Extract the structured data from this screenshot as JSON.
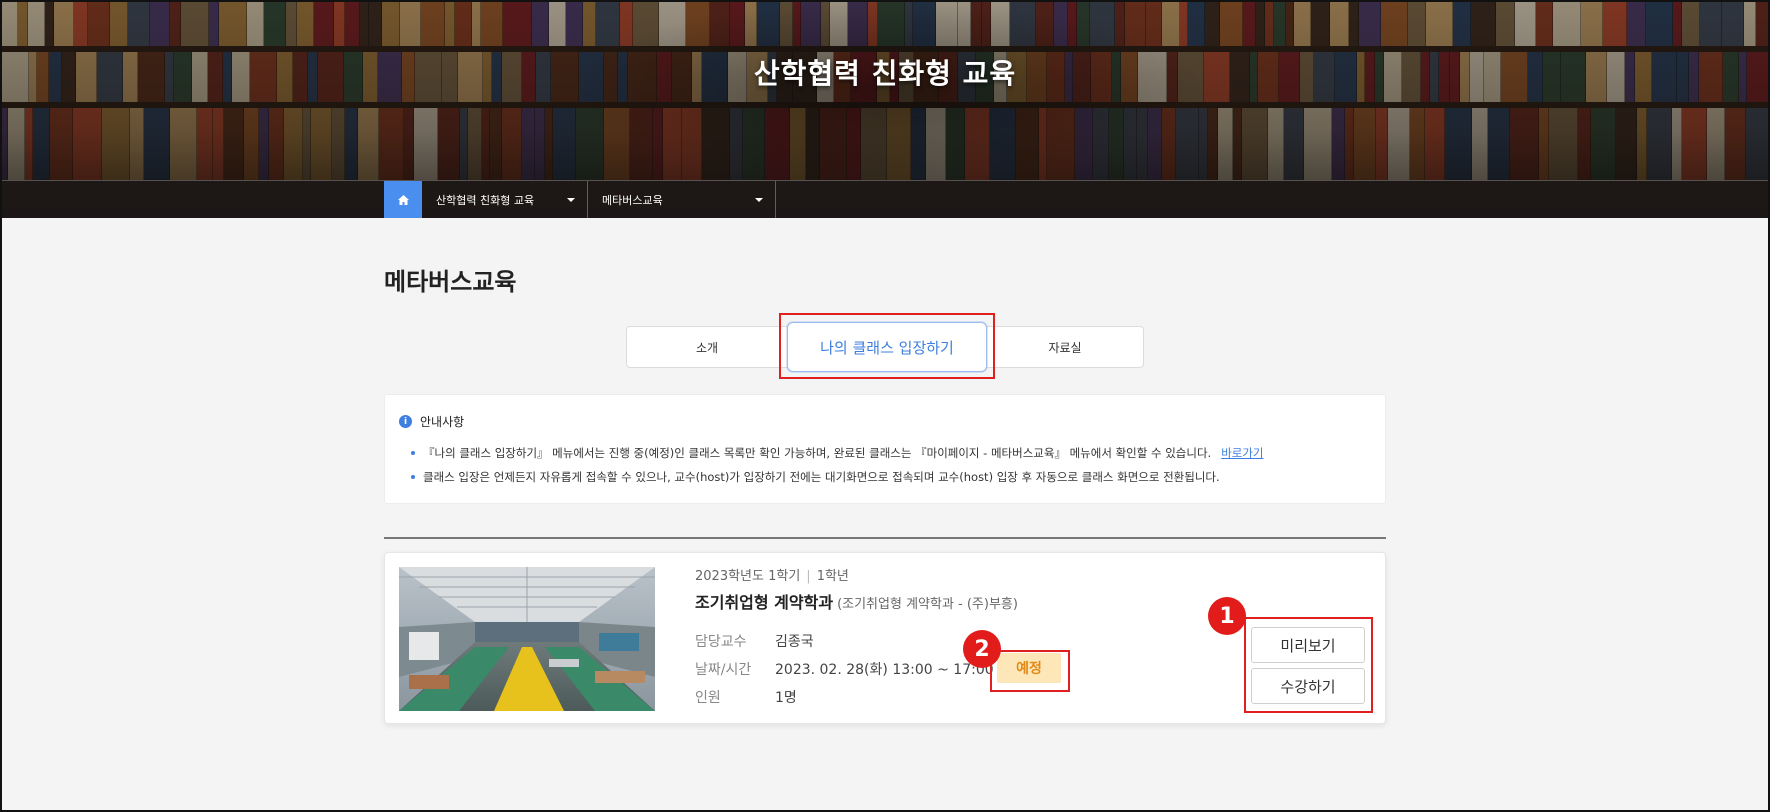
{
  "banner": {
    "title": "산학협력 친화형 교육"
  },
  "nav": {
    "home_icon": "home-icon",
    "item1": "산학협력 친화형 교육",
    "item2": "메타버스교육"
  },
  "page": {
    "title": "메타버스교육"
  },
  "tabs": [
    {
      "label": "소개"
    },
    {
      "label": "나의 클래스 입장하기"
    },
    {
      "label": "자료실"
    }
  ],
  "notice": {
    "heading": "안내사항",
    "line1": "『나의 클래스 입장하기』 메뉴에서는 진행 중(예정)인 클래스 목록만 확인 가능하며, 완료된 클래스는 『마이페이지 - 메타버스교육』 메뉴에서 확인할 수 있습니다.",
    "link": "바로가기",
    "line2": "클래스 입장은 언제든지 자유롭게 접속할 수 있으나, 교수(host)가 입장하기 전에는 대기화면으로 접속되며 교수(host) 입장 후 자동으로 클래스 화면으로 전환됩니다."
  },
  "class_card": {
    "semester": "2023학년도 1학기",
    "grade": "1학년",
    "title": "조기취업형 계약학과",
    "subtitle": "(조기취업형 계약학과 - (주)부흥)",
    "professor_label": "담당교수",
    "professor": "김종국",
    "datetime_label": "날짜/시간",
    "datetime": "2023. 02. 28(화) 13:00 ~ 17:00",
    "people_label": "인원",
    "people": "1명",
    "status": "예정",
    "preview_button": "미리보기",
    "attend_button": "수강하기"
  },
  "annotations": {
    "badge1": "1",
    "badge2": "2"
  },
  "colors": {
    "accent": "#3e7fe0",
    "highlight_red": "#e02020",
    "status_bg": "#fde7b8",
    "status_text": "#e08a18"
  }
}
